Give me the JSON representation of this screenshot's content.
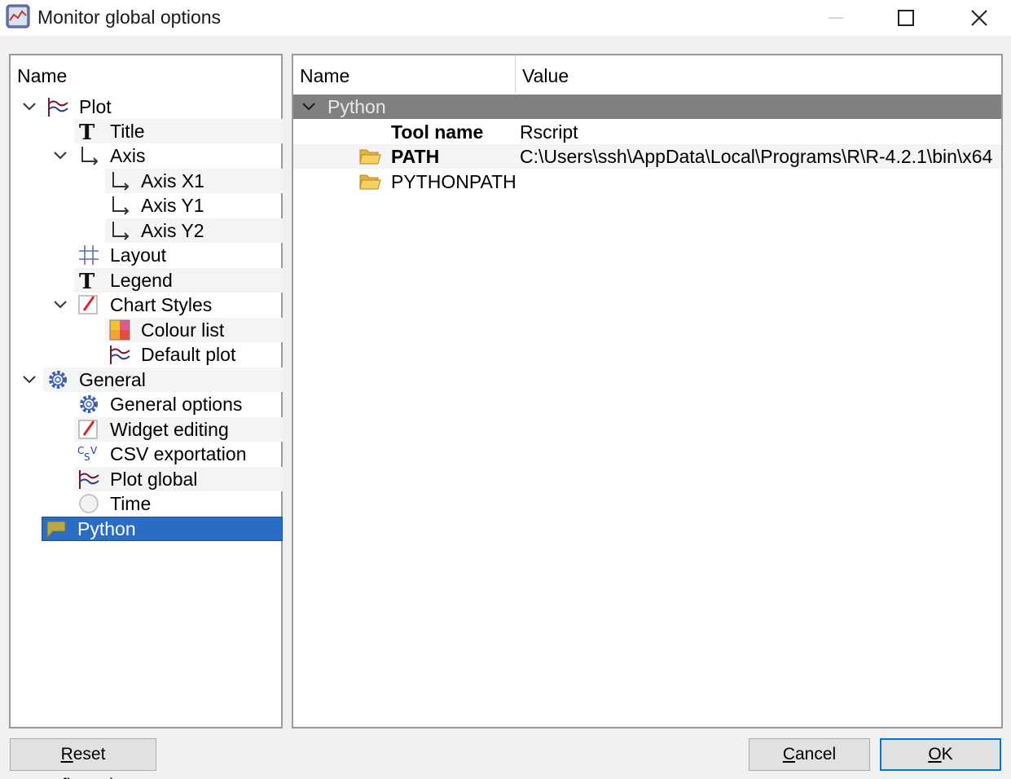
{
  "window": {
    "title": "Monitor global options",
    "icon": "chart-line-icon",
    "controls": [
      "minimize-icon",
      "maximize-icon",
      "close-icon"
    ]
  },
  "tree": {
    "header": "Name",
    "items": [
      {
        "label": "Plot",
        "icon": "plot-icon",
        "depth": 0,
        "expanded": true
      },
      {
        "label": "Title",
        "icon": "text-icon",
        "depth": 1
      },
      {
        "label": "Axis",
        "icon": "axis-icon",
        "depth": 1,
        "expanded": true
      },
      {
        "label": "Axis X1",
        "icon": "axis-icon",
        "depth": 2
      },
      {
        "label": "Axis Y1",
        "icon": "axis-icon",
        "depth": 2
      },
      {
        "label": "Axis Y2",
        "icon": "axis-icon",
        "depth": 2
      },
      {
        "label": "Layout",
        "icon": "grid-icon",
        "depth": 1
      },
      {
        "label": "Legend",
        "icon": "text-icon",
        "depth": 1
      },
      {
        "label": "Chart Styles",
        "icon": "pencil-icon",
        "depth": 1,
        "expanded": true
      },
      {
        "label": "Colour list",
        "icon": "palette-icon",
        "depth": 2
      },
      {
        "label": "Default plot",
        "icon": "plot-icon",
        "depth": 2
      },
      {
        "label": "General",
        "icon": "gear-icon",
        "depth": 0,
        "expanded": true
      },
      {
        "label": "General options",
        "icon": "gear-icon",
        "depth": 1
      },
      {
        "label": "Widget editing",
        "icon": "pencil-icon",
        "depth": 1
      },
      {
        "label": "CSV exportation",
        "icon": "csv-icon",
        "depth": 1
      },
      {
        "label": "Plot global",
        "icon": "plot-icon",
        "depth": 1
      },
      {
        "label": "Time",
        "icon": "clock-icon",
        "depth": 1
      },
      {
        "label": "Python",
        "icon": "python-icon",
        "depth": 0,
        "selected": true
      }
    ]
  },
  "properties": {
    "headers": {
      "name": "Name",
      "value": "Value"
    },
    "group": "Python",
    "rows": [
      {
        "name": "Tool name",
        "value": "Rscript",
        "bold": true,
        "icon": ""
      },
      {
        "name": "PATH",
        "value": "C:\\Users\\ssh\\AppData\\Local\\Programs\\R\\R-4.2.1\\bin\\x64",
        "bold": true,
        "icon": "folder-icon"
      },
      {
        "name": "PYTHONPATH",
        "value": "",
        "bold": false,
        "icon": "folder-icon"
      }
    ]
  },
  "buttons": {
    "reset": {
      "mnemonic": "R",
      "rest": "eset configuration"
    },
    "cancel": {
      "mnemonic": "C",
      "rest": "ancel"
    },
    "ok": {
      "mnemonic": "O",
      "rest": "K"
    }
  },
  "colors": {
    "selection": "#2b6cc4",
    "group_header": "#808080",
    "ok_border": "#0078d7"
  }
}
